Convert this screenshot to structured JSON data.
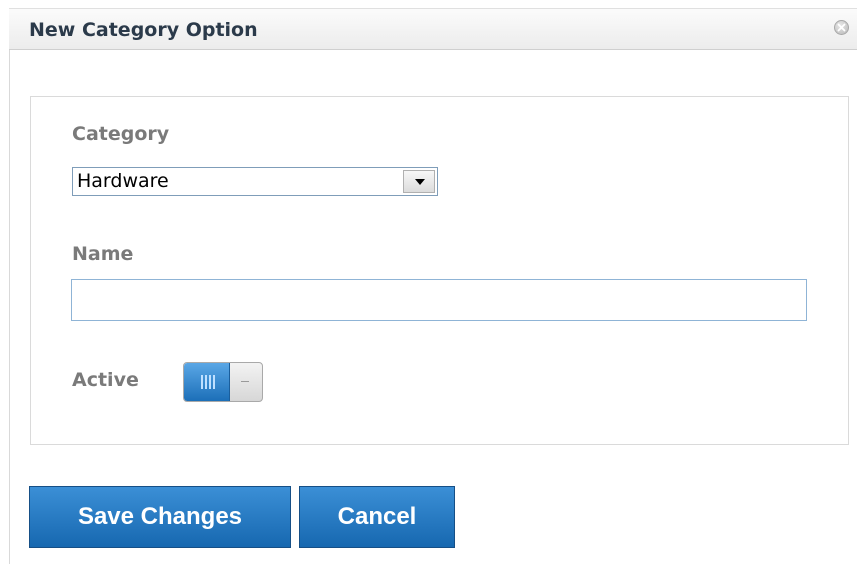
{
  "dialog": {
    "title": "New Category Option",
    "close_icon": "close-icon"
  },
  "form": {
    "category": {
      "label": "Category",
      "selected_value": "Hardware"
    },
    "name": {
      "label": "Name",
      "value": "",
      "placeholder": ""
    },
    "active": {
      "label": "Active",
      "state": "on"
    }
  },
  "buttons": {
    "save_label": "Save Changes",
    "cancel_label": "Cancel"
  },
  "colors": {
    "accent": "#1c6fb8",
    "label_gray": "#7a7a7a",
    "title_text": "#2b3a4a"
  }
}
